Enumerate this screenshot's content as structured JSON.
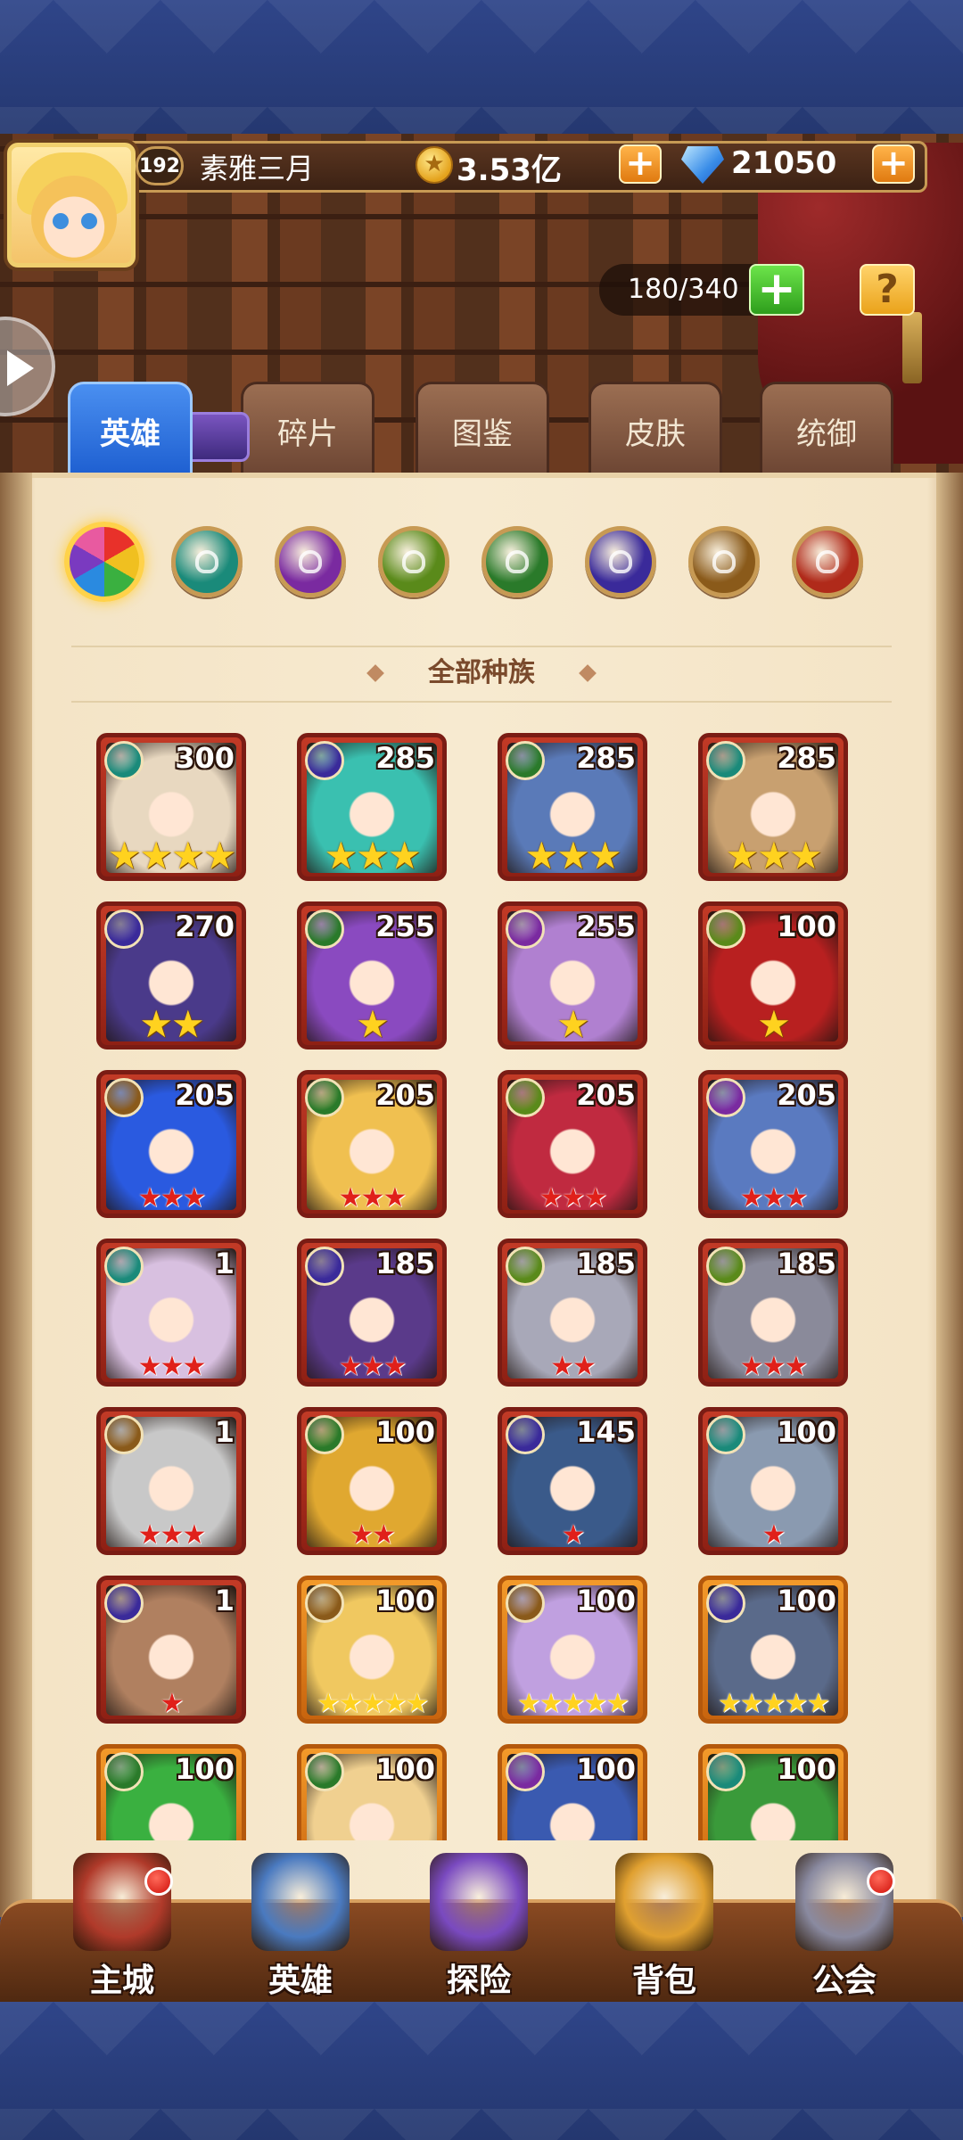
{
  "header": {
    "level": "192",
    "player_name": "素雅三月",
    "coins": "3.53亿",
    "gems": "21050",
    "hero_capacity": "180/340",
    "help_label": "?"
  },
  "tabs": [
    {
      "label": "英雄",
      "active": true
    },
    {
      "label": "碎片",
      "active": false
    },
    {
      "label": "图鉴",
      "active": false
    },
    {
      "label": "皮肤",
      "active": false
    },
    {
      "label": "统御",
      "active": false
    }
  ],
  "race_filters": [
    {
      "name": "all-races-icon",
      "color": "#e85a2a",
      "active": true
    },
    {
      "name": "forest-race-icon",
      "color": "#1a8a7a",
      "active": false
    },
    {
      "name": "shadow-race-icon",
      "color": "#7a2aa0",
      "active": false
    },
    {
      "name": "nature-race-icon",
      "color": "#5a8a1a",
      "active": false
    },
    {
      "name": "leaf-race-icon",
      "color": "#2a7a2a",
      "active": false
    },
    {
      "name": "demon-race-icon",
      "color": "#3a2a9a",
      "active": false
    },
    {
      "name": "light-race-icon",
      "color": "#8a5a1a",
      "active": false
    },
    {
      "name": "fortress-race-icon",
      "color": "#b02a1a",
      "active": false
    }
  ],
  "section_title": "全部种族",
  "heroes": [
    {
      "level": "300",
      "race": "#1a8a7a",
      "portrait": "#e8d8c0",
      "stars": 4,
      "star_type": "gold",
      "frame": "red"
    },
    {
      "level": "285",
      "race": "#3a2a9a",
      "portrait": "#3ac0b0",
      "stars": 3,
      "star_type": "gold",
      "frame": "red"
    },
    {
      "level": "285",
      "race": "#2a7a2a",
      "portrait": "#5a7ab8",
      "stars": 3,
      "star_type": "gold",
      "frame": "red"
    },
    {
      "level": "285",
      "race": "#1a8a7a",
      "portrait": "#c8a070",
      "stars": 3,
      "star_type": "gold",
      "frame": "red"
    },
    {
      "level": "270",
      "race": "#3a2a9a",
      "portrait": "#4a3a8a",
      "stars": 2,
      "star_type": "gold",
      "frame": "red"
    },
    {
      "level": "255",
      "race": "#2a7a2a",
      "portrait": "#8a4ac0",
      "stars": 1,
      "star_type": "gold",
      "frame": "red"
    },
    {
      "level": "255",
      "race": "#7a2aa0",
      "portrait": "#b080d0",
      "stars": 1,
      "star_type": "gold",
      "frame": "red"
    },
    {
      "level": "100",
      "race": "#5a8a1a",
      "portrait": "#b82020",
      "stars": 1,
      "star_type": "gold",
      "frame": "red"
    },
    {
      "level": "205",
      "race": "#8a5a1a",
      "portrait": "#2a5ae0",
      "stars": 3,
      "star_type": "red",
      "frame": "red"
    },
    {
      "level": "205",
      "race": "#2a7a2a",
      "portrait": "#f0c050",
      "stars": 3,
      "star_type": "red",
      "frame": "red"
    },
    {
      "level": "205",
      "race": "#5a8a1a",
      "portrait": "#c02a40",
      "stars": 3,
      "star_type": "red",
      "frame": "red"
    },
    {
      "level": "205",
      "race": "#7a2aa0",
      "portrait": "#5a7ac0",
      "stars": 3,
      "star_type": "red",
      "frame": "red"
    },
    {
      "level": "1",
      "race": "#1a8a7a",
      "portrait": "#d8c0e0",
      "stars": 3,
      "star_type": "red",
      "frame": "red"
    },
    {
      "level": "185",
      "race": "#3a2a9a",
      "portrait": "#5a3a8a",
      "stars": 3,
      "star_type": "red",
      "frame": "red"
    },
    {
      "level": "185",
      "race": "#5a8a1a",
      "portrait": "#a8a8b8",
      "stars": 2,
      "star_type": "red",
      "frame": "red"
    },
    {
      "level": "185",
      "race": "#5a8a1a",
      "portrait": "#8a8a9a",
      "stars": 3,
      "star_type": "red",
      "frame": "red"
    },
    {
      "level": "1",
      "race": "#8a5a1a",
      "portrait": "#c8c8c8",
      "stars": 3,
      "star_type": "red",
      "frame": "red"
    },
    {
      "level": "100",
      "race": "#2a7a2a",
      "portrait": "#e0a830",
      "stars": 2,
      "star_type": "red",
      "frame": "red"
    },
    {
      "level": "145",
      "race": "#3a2a9a",
      "portrait": "#3a5a8a",
      "stars": 1,
      "star_type": "red",
      "frame": "red"
    },
    {
      "level": "100",
      "race": "#1a8a7a",
      "portrait": "#8a9ab0",
      "stars": 1,
      "star_type": "red",
      "frame": "red"
    },
    {
      "level": "1",
      "race": "#3a2a9a",
      "portrait": "#b08060",
      "stars": 1,
      "star_type": "red",
      "frame": "red"
    },
    {
      "level": "100",
      "race": "#8a5a1a",
      "portrait": "#f0c860",
      "stars": 5,
      "star_type": "gold",
      "frame": "orange"
    },
    {
      "level": "100",
      "race": "#8a5a1a",
      "portrait": "#c0a0e0",
      "stars": 5,
      "star_type": "gold",
      "frame": "orange"
    },
    {
      "level": "100",
      "race": "#3a2a9a",
      "portrait": "#5a6a8a",
      "stars": 5,
      "star_type": "gold",
      "frame": "orange"
    },
    {
      "level": "100",
      "race": "#2a7a2a",
      "portrait": "#3ab040",
      "stars": 0,
      "star_type": "gold",
      "frame": "orange"
    },
    {
      "level": "100",
      "race": "#2a7a2a",
      "portrait": "#f0d090",
      "stars": 0,
      "star_type": "gold",
      "frame": "orange"
    },
    {
      "level": "100",
      "race": "#7a2aa0",
      "portrait": "#3a5ab0",
      "stars": 0,
      "star_type": "gold",
      "frame": "orange"
    },
    {
      "level": "100",
      "race": "#1a8a7a",
      "portrait": "#3a9a3a",
      "stars": 0,
      "star_type": "gold",
      "frame": "orange"
    }
  ],
  "bottom_nav": [
    {
      "label": "主城",
      "icon": "castle-icon",
      "color": "#b03a2a",
      "badge": true
    },
    {
      "label": "英雄",
      "icon": "hero-icon",
      "color": "#4a7ac0",
      "badge": false
    },
    {
      "label": "探险",
      "icon": "portal-icon",
      "color": "#7a4ac0",
      "badge": false
    },
    {
      "label": "背包",
      "icon": "bag-icon",
      "color": "#e0a030",
      "badge": false
    },
    {
      "label": "公会",
      "icon": "guild-icon",
      "color": "#8a8aa0",
      "badge": true
    }
  ]
}
